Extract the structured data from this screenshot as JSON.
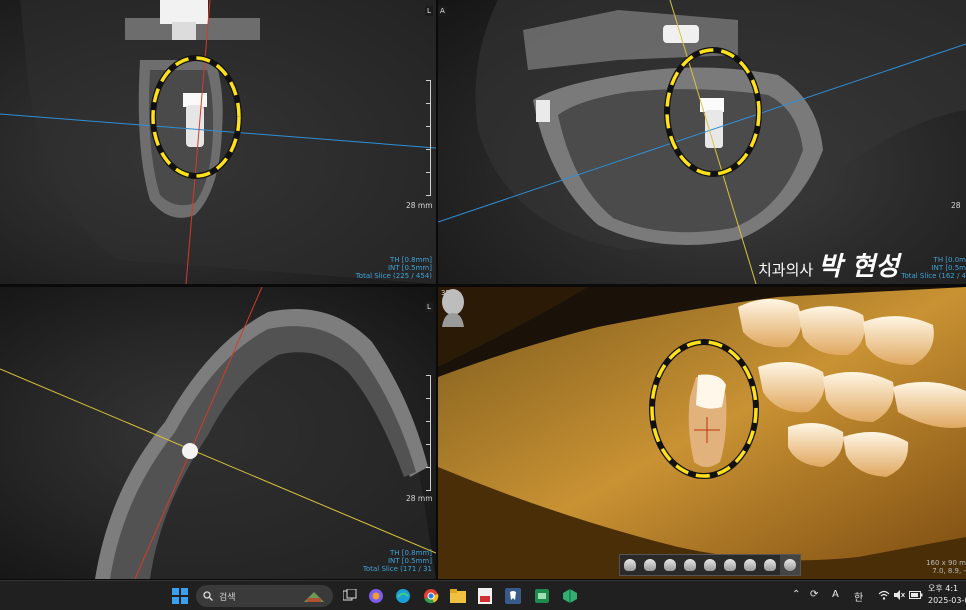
{
  "viewer": {
    "top_left": {
      "orientation": "L",
      "measure": "28 mm",
      "th": "TH [0.8mm]",
      "int": "INT [0.5mm]",
      "slice": "Total Slice (225 / 454)"
    },
    "top_right": {
      "orientation": "A",
      "measure": "28",
      "th": "TH [0.0m",
      "int": "INT [0.5m",
      "slice": "Total Slice (162 / 4"
    },
    "bottom_left": {
      "orientation": "L",
      "measure": "28 mm",
      "th": "TH [0.8mm]",
      "int": "INT [0.5mm]",
      "slice": "Total Slice (171 / 31"
    },
    "bottom_right": {
      "label": "3D",
      "info_line1": "160 x 90 m",
      "info_line2": "7.0, 8.9, -"
    },
    "watermark": {
      "prefix": "치과의사",
      "name": "박 현성"
    }
  },
  "taskbar": {
    "search_placeholder": "검색",
    "tray_lang_a": "A",
    "tray_lang_ko": "한",
    "clock_time": "오후 4:1",
    "clock_date": "2025-03-0",
    "apps": [
      "windows-start",
      "search",
      "task-view",
      "copilot",
      "edge",
      "chrome",
      "file-explorer",
      "app-pdf",
      "app-dental",
      "app-green",
      "app-3d"
    ]
  },
  "colors": {
    "annotation": "#ffe11a",
    "blue_line": "#2f8fd6",
    "red_line": "#d63a2a",
    "yellow_line": "#d8c43a",
    "info_text": "#3fa3d8"
  }
}
